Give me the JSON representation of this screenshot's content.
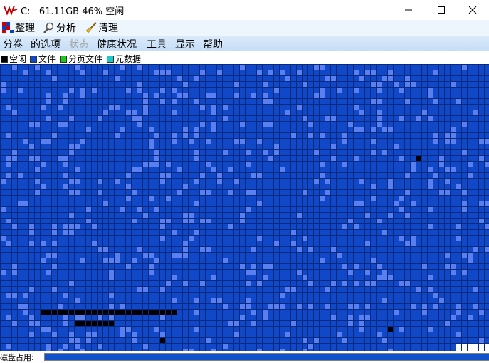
{
  "window": {
    "title": "C:   61.11GB 46% 空闲",
    "controls": [
      "minimize-icon",
      "maximize-icon",
      "close-icon"
    ]
  },
  "toolbar": [
    {
      "label": "整理",
      "icon": "defrag-icon"
    },
    {
      "label": "分析",
      "icon": "magnifier-icon"
    },
    {
      "label": "清理",
      "icon": "broom-icon"
    }
  ],
  "menu": [
    {
      "label": "分卷",
      "enabled": true
    },
    {
      "label": "的选项",
      "enabled": true
    },
    {
      "label": "状态",
      "enabled": false
    },
    {
      "label": "健康状况",
      "enabled": true
    },
    {
      "label": "工具",
      "enabled": true
    },
    {
      "label": "显示",
      "enabled": true
    },
    {
      "label": "帮助",
      "enabled": true
    }
  ],
  "legend": [
    {
      "label": "空闲",
      "color": "#000000"
    },
    {
      "label": "文件",
      "color": "#1048c8"
    },
    {
      "label": "分页文件",
      "color": "#1ec81e"
    },
    {
      "label": "元数据",
      "color": "#20c8c8"
    }
  ],
  "map": {
    "colors": {
      "file": "#1048c8",
      "file_alt": "#5a7ff0",
      "free": "#000000",
      "empty": "#ffffff",
      "grid": "#0a2a80"
    }
  },
  "status": {
    "label": "磁盘占用:",
    "used_fraction": 1.0
  }
}
